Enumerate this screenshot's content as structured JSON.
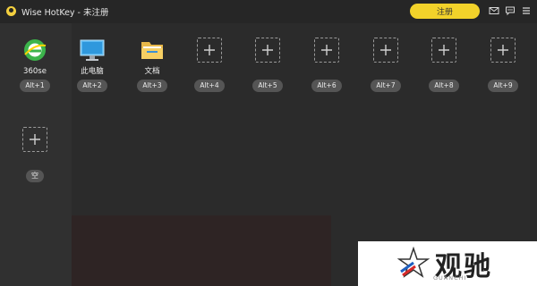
{
  "window": {
    "title": "Wise HotKey - 未注册"
  },
  "titlebar": {
    "register_label": "注册",
    "icons": [
      "mail-icon",
      "feedback-icon",
      "menu-icon"
    ]
  },
  "slots": [
    {
      "name": "360se",
      "hotkey": "Alt+1",
      "icon": "360se-browser-icon"
    },
    {
      "name": "此电脑",
      "hotkey": "Alt+2",
      "icon": "computer-icon"
    },
    {
      "name": "文档",
      "hotkey": "Alt+3",
      "icon": "folder-icon"
    },
    {
      "name": "",
      "hotkey": "Alt+4",
      "icon": "add-icon"
    },
    {
      "name": "",
      "hotkey": "Alt+5",
      "icon": "add-icon"
    },
    {
      "name": "",
      "hotkey": "Alt+6",
      "icon": "add-icon"
    },
    {
      "name": "",
      "hotkey": "Alt+7",
      "icon": "add-icon"
    },
    {
      "name": "",
      "hotkey": "Alt+8",
      "icon": "add-icon"
    },
    {
      "name": "",
      "hotkey": "Alt+9",
      "icon": "add-icon"
    }
  ],
  "single_slot": {
    "label": "空",
    "icon": "add-icon"
  },
  "watermark": {
    "brand": "观驰",
    "sub": "GUANCHI"
  },
  "colors": {
    "accent": "#f2d22a",
    "background": "#2b2b2b",
    "pill": "#555555"
  }
}
